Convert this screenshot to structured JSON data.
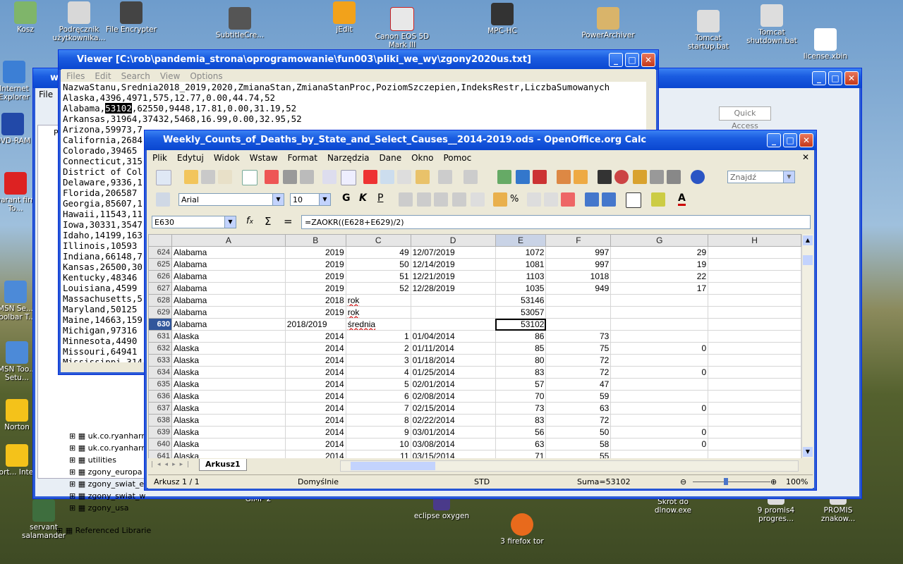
{
  "desktop": {
    "icons": [
      {
        "label": "Kosz"
      },
      {
        "label": "Podręcznik użytkownika..."
      },
      {
        "label": "File Encrypter"
      },
      {
        "label": "SubtitleCre..."
      },
      {
        "label": "jEdit"
      },
      {
        "label": "Canon EOS 5D Mark III"
      },
      {
        "label": "MPC-HC"
      },
      {
        "label": "PowerArchiver"
      },
      {
        "label": "Tomcat startup.bat"
      },
      {
        "label": "Tomcat shutdown.bat"
      },
      {
        "label": "license.xbin"
      },
      {
        "label": "Internet Explorer"
      },
      {
        "label": "DVD-RAM"
      },
      {
        "label": "Gwarant firmy To..."
      },
      {
        "label": "MSN Se... Toolbar T..."
      },
      {
        "label": "MSN Too... Setu..."
      },
      {
        "label": "Norton"
      },
      {
        "label": "Nort... Inte..."
      },
      {
        "label": "servant salamander"
      },
      {
        "label": "GIMP 2"
      },
      {
        "label": "eclipse oxygen"
      },
      {
        "label": "3 firefox tor"
      },
      {
        "label": "Skrót do dlnow.exe"
      },
      {
        "label": "9 promis4 progres..."
      },
      {
        "label": "PROMIS znakow..."
      }
    ]
  },
  "viewer": {
    "title": "Viewer [C:\\rob\\pandemia_strona\\oprogramowanie\\fun003\\pliki_we_wy\\zgony2020us.txt]",
    "menu": [
      "Files",
      "Edit",
      "Search",
      "View",
      "Options"
    ],
    "lines": [
      "NazwaStanu,Srednia2018_2019,2020,ZmianaStan,ZmianaStanProc,PoziomSzczepien,IndeksRestr,LiczbaSumowanych",
      "Alaska,4396,4971,575,12.77,0.00,44.74,52",
      "Alabama,",
      "Arkansas,31964,37432,5468,16.99,0.00,32.95,52",
      "Arizona,59973,7",
      "California,2684",
      "Colorado,39465",
      "Connecticut,315",
      "District of Col",
      "Delaware,9336,1",
      "Florida,206587",
      "Georgia,85607,1",
      "Hawaii,11543,11",
      "Iowa,30331,3547",
      "Idaho,14199,163",
      "Illinois,10593",
      "Indiana,66148,7",
      "Kansas,26500,30",
      "Kentucky,48346",
      "Louisiana,4599",
      "Massachusetts,5",
      "Maryland,50125",
      "Maine,14663,159",
      "Michigan,97316",
      "Minnesota,4490",
      "Missouri,64941",
      "Mississippi,314"
    ],
    "alabama_highlight": "53102",
    "alabama_rest": ",62550,9448,17.81,0.00,31.19,52"
  },
  "eclipse": {
    "title": "w",
    "menu_first": "File",
    "quick_access": "Quick Access",
    "tree_items": [
      "uk.co.ryanharr",
      "uk.co.ryanharr",
      "utilities",
      "zgony_europa",
      "zgony_swiat_e",
      "zgony_swiat_w",
      "zgony_usa",
      "Referenced Librarie"
    ],
    "tree_tab_label": "Pa"
  },
  "calc": {
    "title": "Weekly_Counts_of_Deaths_by_State_and_Select_Causes__2014-2019.ods - OpenOffice.org Calc",
    "menu": [
      "Plik",
      "Edytuj",
      "Widok",
      "Wstaw",
      "Format",
      "Narzędzia",
      "Dane",
      "Okno",
      "Pomoc"
    ],
    "find_placeholder": "Znajdź",
    "font_name": "Arial",
    "font_size": "10",
    "name_box": "E630",
    "formula": "=ZAOKR((E628+E629)/2)",
    "columns": [
      "A",
      "B",
      "C",
      "D",
      "E",
      "F",
      "G",
      "H"
    ],
    "selected_column": "E",
    "selected_row": "630",
    "rows": [
      {
        "n": "624",
        "a": "Alabama",
        "b": "2019",
        "c": "49",
        "d": "12/07/2019",
        "e": "1072",
        "f": "997",
        "g": "29"
      },
      {
        "n": "625",
        "a": "Alabama",
        "b": "2019",
        "c": "50",
        "d": "12/14/2019",
        "e": "1081",
        "f": "997",
        "g": "19"
      },
      {
        "n": "626",
        "a": "Alabama",
        "b": "2019",
        "c": "51",
        "d": "12/21/2019",
        "e": "1103",
        "f": "1018",
        "g": "22"
      },
      {
        "n": "627",
        "a": "Alabama",
        "b": "2019",
        "c": "52",
        "d": "12/28/2019",
        "e": "1035",
        "f": "949",
        "g": "17"
      },
      {
        "n": "628",
        "a": "Alabama",
        "b": "2018",
        "c": "rok",
        "d": "",
        "e": "53146",
        "f": "",
        "g": ""
      },
      {
        "n": "629",
        "a": "Alabama",
        "b": "2019",
        "c": "rok",
        "d": "",
        "e": "53057",
        "f": "",
        "g": ""
      },
      {
        "n": "630",
        "a": "Alabama",
        "b": "2018/2019",
        "c": "średnia",
        "d": "",
        "e": "53102",
        "f": "",
        "g": ""
      },
      {
        "n": "631",
        "a": "Alaska",
        "b": "2014",
        "c": "1",
        "d": "01/04/2014",
        "e": "86",
        "f": "73",
        "g": ""
      },
      {
        "n": "632",
        "a": "Alaska",
        "b": "2014",
        "c": "2",
        "d": "01/11/2014",
        "e": "85",
        "f": "75",
        "g": "0"
      },
      {
        "n": "633",
        "a": "Alaska",
        "b": "2014",
        "c": "3",
        "d": "01/18/2014",
        "e": "80",
        "f": "72",
        "g": ""
      },
      {
        "n": "634",
        "a": "Alaska",
        "b": "2014",
        "c": "4",
        "d": "01/25/2014",
        "e": "83",
        "f": "72",
        "g": "0"
      },
      {
        "n": "635",
        "a": "Alaska",
        "b": "2014",
        "c": "5",
        "d": "02/01/2014",
        "e": "57",
        "f": "47",
        "g": ""
      },
      {
        "n": "636",
        "a": "Alaska",
        "b": "2014",
        "c": "6",
        "d": "02/08/2014",
        "e": "70",
        "f": "59",
        "g": ""
      },
      {
        "n": "637",
        "a": "Alaska",
        "b": "2014",
        "c": "7",
        "d": "02/15/2014",
        "e": "73",
        "f": "63",
        "g": "0"
      },
      {
        "n": "638",
        "a": "Alaska",
        "b": "2014",
        "c": "8",
        "d": "02/22/2014",
        "e": "83",
        "f": "72",
        "g": ""
      },
      {
        "n": "639",
        "a": "Alaska",
        "b": "2014",
        "c": "9",
        "d": "03/01/2014",
        "e": "56",
        "f": "50",
        "g": "0"
      },
      {
        "n": "640",
        "a": "Alaska",
        "b": "2014",
        "c": "10",
        "d": "03/08/2014",
        "e": "63",
        "f": "58",
        "g": "0"
      },
      {
        "n": "641",
        "a": "Alaska",
        "b": "2014",
        "c": "11",
        "d": "03/15/2014",
        "e": "71",
        "f": "55",
        "g": ""
      }
    ],
    "sheet_tab": "Arkusz1",
    "status": {
      "sheet": "Arkusz 1 / 1",
      "style": "Domyślnie",
      "mode": "STD",
      "sum": "Suma=53102",
      "zoom": "100%"
    }
  }
}
